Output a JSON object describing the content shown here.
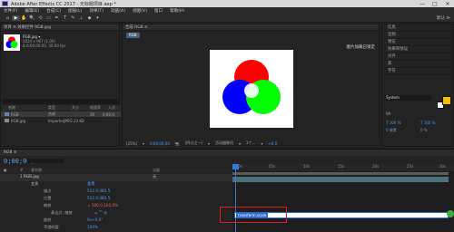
{
  "titlebar": {
    "title": "Adobe After Effects CC 2017 - 无标题项目.aep *",
    "buttons": [
      "—",
      "□",
      "✕"
    ]
  },
  "menubar": [
    "文件(F)",
    "编辑(E)",
    "合成(C)",
    "图层(L)",
    "效果(T)",
    "动画(A)",
    "视图(V)",
    "窗口",
    "帮助(H)"
  ],
  "toolbar": {
    "tools": [
      "⌂",
      "▶",
      "✋",
      "🔍",
      "⟲",
      "▭",
      "✒",
      "T",
      "✎",
      "⊥",
      "◆",
      "✦"
    ],
    "right_label": "默认 ≫"
  },
  "project": {
    "header": "项目 ≡   效果控件 RGB.jpg",
    "item_name": "RGB.jpg ▾",
    "item_info": [
      "1024 x 967 (1.00)",
      "Δ 0;00;00;00, 30.00 fps"
    ],
    "columns": [
      "名称",
      "类型",
      "大小",
      "帧速率",
      "入点"
    ],
    "rows": [
      {
        "name": "RGB",
        "type": "合成",
        "size": "",
        "fps": "30",
        "in": "0;00;0"
      },
      {
        "name": "RGB.jpg",
        "type": "ImporterJPEG",
        "size": "23 KB",
        "fps": "",
        "in": ""
      }
    ]
  },
  "comp": {
    "header": "合成 RGB ≡",
    "tab_label": "RGB",
    "note": "图片加载已锁定",
    "footer": [
      "[25%]",
      "▾",
      "0;00;00;00",
      "📷",
      "(四分之一)",
      "▾",
      "活动摄像机",
      "▾",
      "1个...",
      "▾",
      "+0.0"
    ]
  },
  "right_panels": {
    "items": [
      "信息",
      "音频",
      "预览",
      "效果和预设",
      "对齐",
      "库",
      "字符"
    ],
    "font_name": "System",
    "tracking_label": "VA",
    "size_label": "T 100 %",
    "size_value": "T 100 %",
    "extra": [
      "0 像素",
      "0 %"
    ]
  },
  "timeline": {
    "tab": "RGB ≡",
    "time": "0;00;00;00",
    "header_cols": [
      "●",
      "#",
      "源名称",
      "父级"
    ],
    "ruler_marks": [
      "0s",
      "05s",
      "10s",
      "15s",
      "20s",
      "25s",
      "30s"
    ],
    "rows": [
      {
        "label": "1  RGB.jpg",
        "value": "无",
        "kind": "layer"
      },
      {
        "label": "变换",
        "value": "重置",
        "kind": "group"
      },
      {
        "label": "锚点",
        "value": "512.0,483.5",
        "kind": "prop"
      },
      {
        "label": "位置",
        "value": "512.0,483.5",
        "kind": "prop"
      },
      {
        "label": "缩放",
        "value": "∞ 100.0,100.0%",
        "kind": "prop"
      },
      {
        "label": "表达式: 缩放",
        "value": "",
        "kind": "expr"
      },
      {
        "label": "旋转",
        "value": "0x+0.0°",
        "kind": "prop"
      },
      {
        "label": "不透明度",
        "value": "100%",
        "kind": "prop"
      }
    ],
    "expression_text": "transform.scale"
  },
  "colors": {
    "accent_blue": "#2f7ad8",
    "highlight_red": "#e02020",
    "fill_swatch": "#f2c000",
    "circle_red": "#ff0000",
    "circle_green": "#00ff00",
    "circle_blue": "#0000ff"
  }
}
